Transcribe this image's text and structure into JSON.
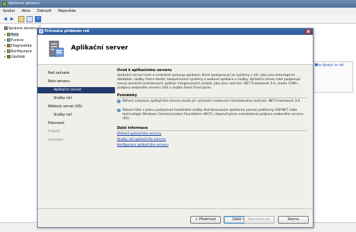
{
  "main_window": {
    "title": "Správce serveru",
    "menu": [
      "Soubor",
      "Akce",
      "Zobrazit",
      "Nápověda"
    ],
    "tree": [
      {
        "label": "Správce serveru (...",
        "level": 0,
        "expander": ""
      },
      {
        "label": "Role",
        "level": 1,
        "expander": "+"
      },
      {
        "label": "Funkce",
        "level": 1,
        "expander": "+"
      },
      {
        "label": "Diagnostika",
        "level": 1,
        "expander": "+"
      },
      {
        "label": "Konfigurace",
        "level": 1,
        "expander": "+"
      },
      {
        "label": "Úložiště",
        "level": 1,
        "expander": "+"
      }
    ],
    "side_link": "lp týkající se rolí"
  },
  "wizard": {
    "title": "Průvodce přidáním rolí",
    "close_label": "X",
    "heading": "Aplikační server",
    "steps": [
      {
        "label": "Než začnete",
        "sub": false,
        "state": "normal"
      },
      {
        "label": "Role serveru",
        "sub": false,
        "state": "normal"
      },
      {
        "label": "Aplikační server",
        "sub": true,
        "state": "active"
      },
      {
        "label": "Služby rolí",
        "sub": true,
        "state": "normal"
      },
      {
        "label": "Webový server (IIS)",
        "sub": false,
        "state": "normal"
      },
      {
        "label": "Služby rolí",
        "sub": true,
        "state": "normal"
      },
      {
        "label": "Potvrzení",
        "sub": false,
        "state": "normal"
      },
      {
        "label": "Průběh",
        "sub": false,
        "state": "dim"
      },
      {
        "label": "Výsledky",
        "sub": false,
        "state": "dim"
      }
    ],
    "intro_title": "Úvod k aplikačnímu serveru",
    "intro_text": "Aplikační server hostí a centrálně spravuje aplikace, které spolupracují se systémy v síti, jako jsou heterogenní databáze, služby řízení identit, bezpečnostní systémy a webové aplikace a služby. Aplikační server také podporuje rozvoj vlastních podnikových aplikací integrovaných služeb, jako jsou rozhraní .NET Framework 3.0, model COM+, podpora webového serveru (IIS) a služba řízení front zpráv.",
    "notes_title": "Poznámky",
    "notes": [
      "Během instalace aplikačního serveru bude při výchozím nastavení nainstalováno rozhraní .NET Framework 3.0.",
      "Pokud máte v plánu poskytovat hostitelské služby distribuovaným aplikacím pomocí platformy ASP.NET nebo technologie Windows Communication Foundation (WCF), doporučujeme nainstalovat podporu webového serveru (IIS)."
    ],
    "info_title": "Další informace",
    "links": [
      "Přehled aplikačního serveru",
      "Služby rolí aplikačního serveru",
      "Konfigurace aplikačního serveru"
    ],
    "buttons": {
      "back": "< Předchozí",
      "next": "Další >",
      "install": "Nainstalovat",
      "cancel": "Storno"
    },
    "colors": {
      "active_step": "#22396d",
      "link": "#0033aa",
      "title_bar": "#2b5796"
    }
  }
}
